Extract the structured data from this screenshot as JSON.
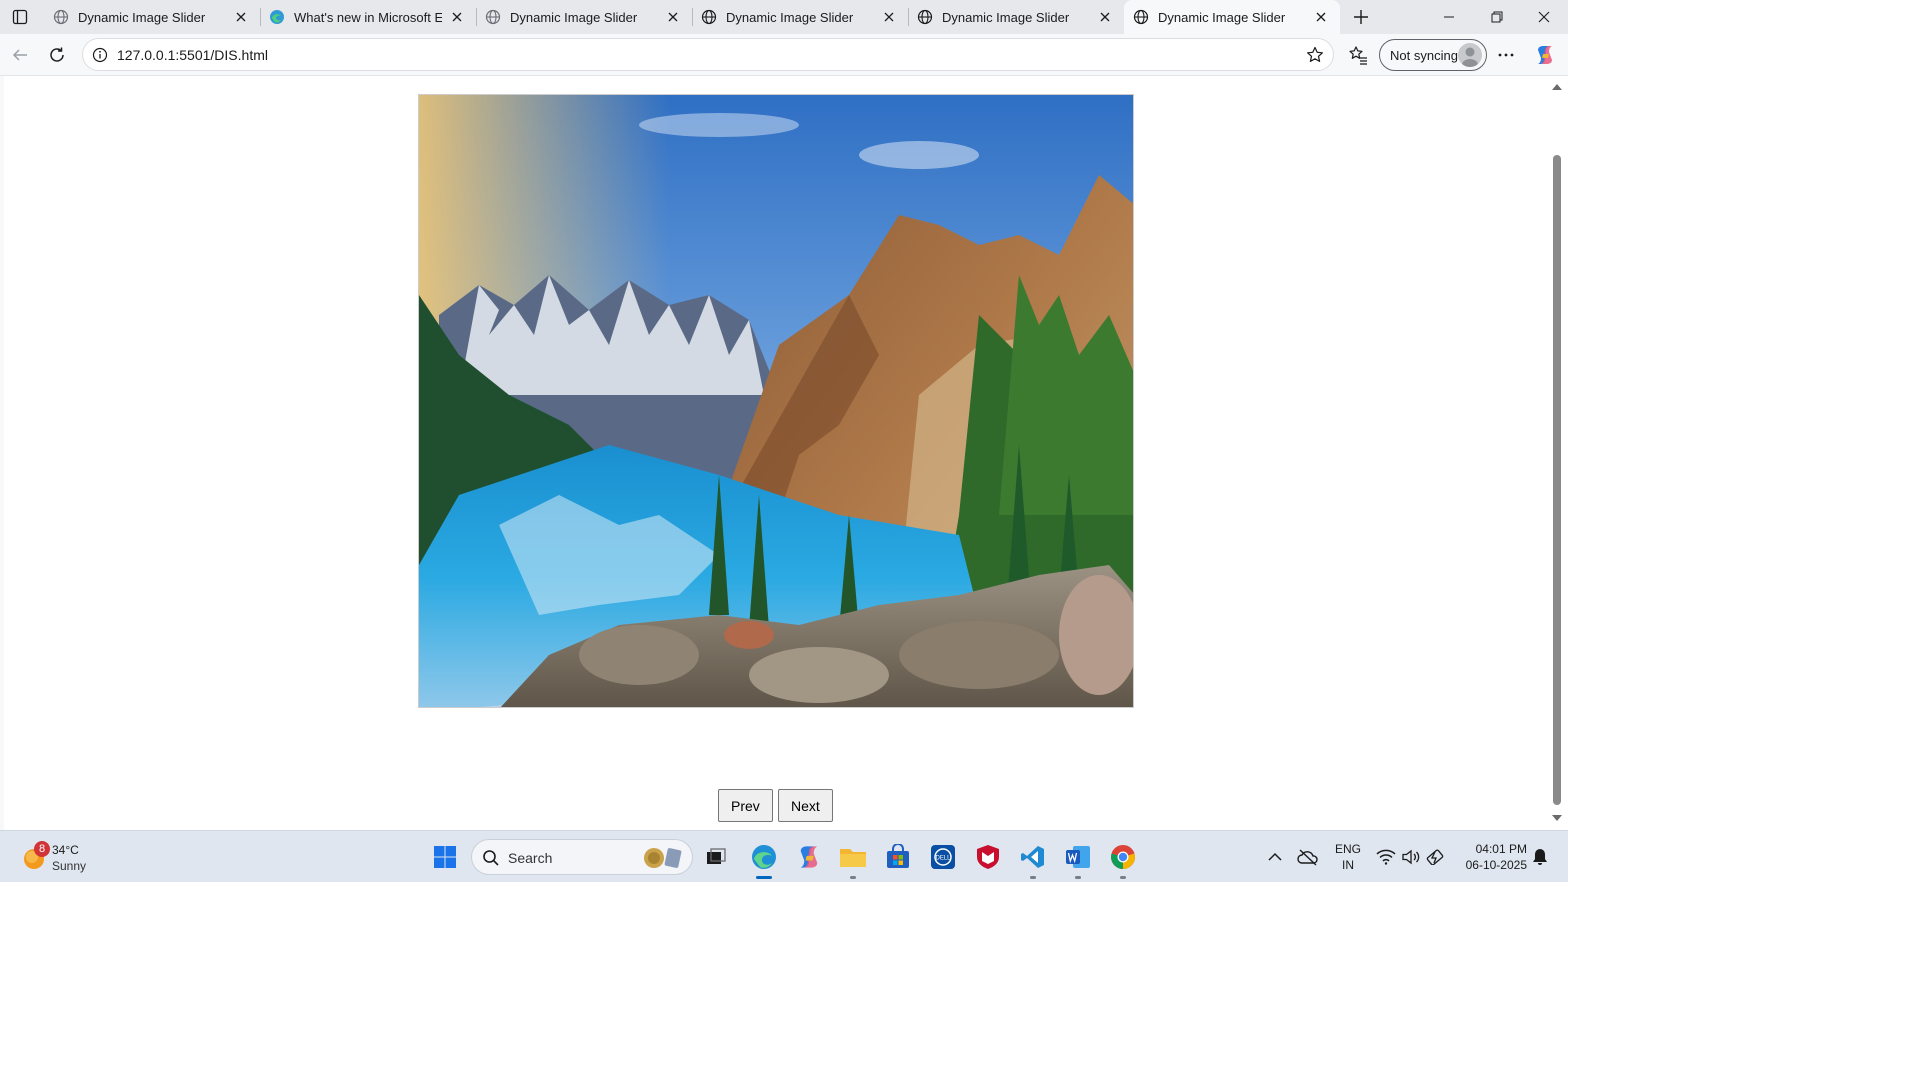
{
  "browser": {
    "tabs": [
      {
        "title": "Dynamic Image Slider",
        "icon": "globe-icon"
      },
      {
        "title": "What's new in Microsoft Edge",
        "icon": "edge-icon"
      },
      {
        "title": "Dynamic Image Slider",
        "icon": "globe-icon"
      },
      {
        "title": "Dynamic Image Slider",
        "icon": "globe-icon"
      },
      {
        "title": "Dynamic Image Slider",
        "icon": "globe-icon"
      },
      {
        "title": "Dynamic Image Slider",
        "icon": "globe-icon"
      }
    ],
    "active_tab_index": 5,
    "url": "127.0.0.1:5501/DIS.html",
    "sync_label": "Not syncing"
  },
  "page": {
    "slide_image_alt": "Mountain lake landscape",
    "prev_label": "Prev",
    "next_label": "Next"
  },
  "taskbar": {
    "weather": {
      "temp": "34°C",
      "condition": "Sunny",
      "badge": "8"
    },
    "search_placeholder": "Search",
    "language": {
      "line1": "ENG",
      "line2": "IN"
    },
    "clock": {
      "time": "04:01 PM",
      "date": "06-10-2025"
    },
    "apps": [
      "start-icon",
      "search-icon",
      "task-view-icon",
      "edge-icon",
      "copilot-icon",
      "file-explorer-icon",
      "store-icon",
      "dell-icon",
      "mcafee-icon",
      "vscode-icon",
      "word-icon",
      "chrome-icon"
    ]
  },
  "colors": {
    "accent": "#0067c0",
    "tabbar": "#e6e8ec",
    "toolbar": "#f7f8fa",
    "taskbar": "#dfe6ef"
  }
}
